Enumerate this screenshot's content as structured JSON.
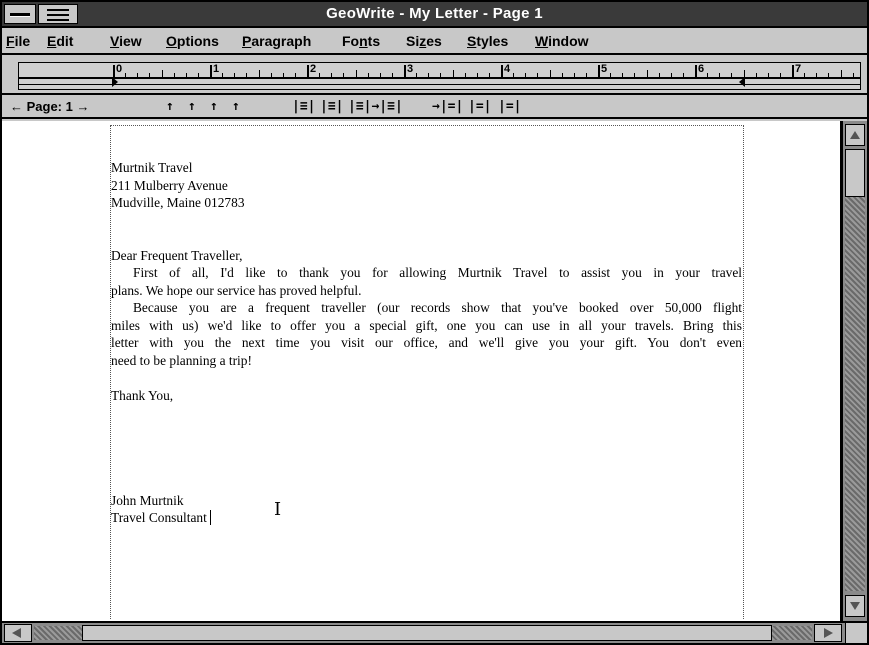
{
  "window": {
    "title": "GeoWrite -  My Letter - Page 1"
  },
  "menu": {
    "items": [
      {
        "pre": "",
        "u": "F",
        "post": "ile"
      },
      {
        "pre": "",
        "u": "E",
        "post": "dit"
      },
      {
        "pre": "",
        "u": "V",
        "post": "iew"
      },
      {
        "pre": "",
        "u": "O",
        "post": "ptions"
      },
      {
        "pre": "",
        "u": "P",
        "post": "aragraph"
      },
      {
        "pre": "Fo",
        "u": "n",
        "post": "ts"
      },
      {
        "pre": "Si",
        "u": "z",
        "post": "es"
      },
      {
        "pre": "",
        "u": "S",
        "post": "tyles"
      },
      {
        "pre": "",
        "u": "W",
        "post": "indow"
      }
    ]
  },
  "ruler": {
    "numbers": [
      "0",
      "1",
      "2",
      "3",
      "4",
      "5",
      "6",
      "7"
    ]
  },
  "toolbar": {
    "page_label": "← Page: 1 →",
    "tab_icons": [
      "↑",
      "↑",
      "↑",
      "↑"
    ],
    "align_icons": [
      "|≡|",
      "|≡|",
      "|≡|→|≡|",
      "→|=|",
      "|=|",
      "|=|"
    ]
  },
  "document": {
    "address": [
      "Murtnik Travel",
      "211 Mulberry Avenue",
      "Mudville, Maine 012783"
    ],
    "salutation": "Dear Frequent Traveller,",
    "para1_line1": "First of all, I'd like to thank you for allowing Murtnik Travel to assist you in your travel",
    "para1_line2": "plans. We hope our service has proved helpful.",
    "para2_line1": "Because you are a frequent traveller (our records show that you've booked over 50,000 flight",
    "para2_line2": "miles with us) we'd like to offer you a special gift, one you can use in all your travels. Bring this",
    "para2_line3": "letter with you the next time you visit our office, and we'll give you your gift. You don't even",
    "para2_line4": "need to be planning a trip!",
    "closing": "Thank You,",
    "signature_name": "John Murtnik",
    "signature_title": "Travel Consultant"
  },
  "colors": {
    "title_bar": "#3a3a3a",
    "chrome": "#c8c8c8",
    "scroll_track": "#8a8a8a"
  }
}
